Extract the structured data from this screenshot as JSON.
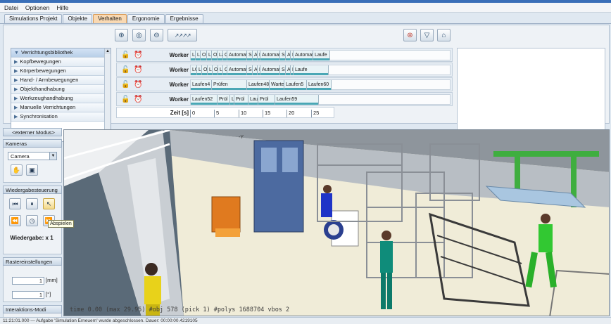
{
  "menu": [
    "Datei",
    "Optionen",
    "Hilfe"
  ],
  "tabs": [
    {
      "label": "Simulations Projekt",
      "active": false
    },
    {
      "label": "Objekte",
      "active": false
    },
    {
      "label": "Verhalten",
      "active": true
    },
    {
      "label": "Ergonomie",
      "active": false
    },
    {
      "label": "Ergebnisse",
      "active": false
    }
  ],
  "toolbar": {
    "zoom_in_icon": "zoom-in-icon",
    "zoom_fit_icon": "zoom-fit-icon",
    "zoom_out_icon": "zoom-out-icon",
    "walk_icon": "walking-figures-icon",
    "record_icon": "record-icon",
    "cart_icon": "cart-icon",
    "home_icon": "home-icon"
  },
  "library": {
    "items": [
      {
        "label": "Verrichtungsbibliothek",
        "selected": true
      },
      {
        "label": "Kopfbewegungen"
      },
      {
        "label": "Körperbewegungen"
      },
      {
        "label": "Hand- / Armbewegungen"
      },
      {
        "label": "Objekthandhabung"
      },
      {
        "label": "Werkzeughandhabung"
      },
      {
        "label": "Manuelle Verrichtungen"
      },
      {
        "label": "Synchronisation"
      }
    ]
  },
  "gantt": {
    "rows": [
      {
        "worker": "Worker",
        "bars": [
          "LC",
          "Laufe",
          "Ob",
          "Lau",
          "Ob",
          "Lau",
          "Ob",
          "Automati",
          "Sc",
          "At",
          "H",
          "Automati",
          "Sc",
          "At",
          "H",
          "Automati",
          "Laufe"
        ]
      },
      {
        "worker": "Worker",
        "bars": [
          "LO",
          "Laufe",
          "Ob",
          "Lau",
          "Ob",
          "Lau",
          "Ob",
          "Automati",
          "Sc",
          "At",
          "H",
          "Automati",
          "Sc",
          "At",
          "H",
          "Laufe"
        ]
      },
      {
        "worker": "Worker",
        "bars": [
          "Laufen4",
          "Prüfen",
          "Laufen48",
          "Warte",
          "Laufen5",
          "Laufen60"
        ]
      },
      {
        "worker": "Worker",
        "bars": [
          "Laufen52",
          "Prül",
          "La",
          "Prül",
          "Laul",
          "Prül",
          "Laufen59"
        ]
      }
    ],
    "time_label": "Zeit [s]",
    "ticks": [
      "0",
      "5",
      "10",
      "15",
      "20",
      "25"
    ]
  },
  "side": {
    "mode_button": "<externer Modus>",
    "cameras_header": "Kameras",
    "camera_select": "Camera",
    "playback_header": "Wiedergabesteuerung",
    "tooltip": "Abspielen",
    "playback_speed": "Wiedergabe: x 1",
    "grid_header": "Rastereinstellungen",
    "grid_value_1": "1",
    "grid_unit_1": "[mm]",
    "grid_value_2": "1",
    "grid_unit_2": "[°]",
    "interaction_header": "Interaktions-Modi"
  },
  "viewport": {
    "hud_text": "time 0.00  (max 29.95)  #obj 578  (pick 1)  #polys 1688704  vbos 2",
    "axis_label": "-Y"
  },
  "status": {
    "text": "11:21:01.000 — Aufgabe 'Simulation Erneuern' wurde abgeschlossen. Dauer: 00:00:00.4219105"
  }
}
